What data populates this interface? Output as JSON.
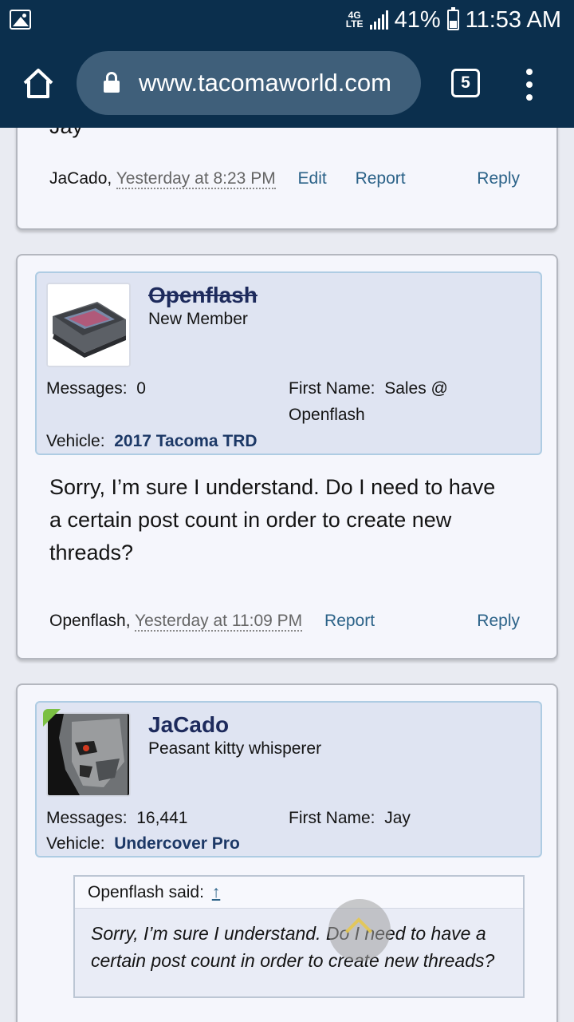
{
  "status_bar": {
    "network": "4G LTE",
    "battery": "41%",
    "time": "11:53 AM"
  },
  "browser": {
    "url": "www.tacomaworld.com",
    "tab_count": "5"
  },
  "posts": [
    {
      "partial_text": "Jay",
      "footer": {
        "author": "JaCado,",
        "date": "Yesterday at 8:23 PM",
        "edit_label": "Edit",
        "report_label": "Report",
        "reply_label": "Reply"
      }
    },
    {
      "user": {
        "name": "Openflash",
        "title": "New Member",
        "messages_label": "Messages:",
        "messages_value": "0",
        "first_name_label": "First Name:",
        "first_name_value": "Sales @",
        "first_name_value_2": "Openflash",
        "vehicle_label": "Vehicle:",
        "vehicle_value": "2017 Tacoma TRD"
      },
      "message_line_1": "Sorry, I’m sure I understand. Do I need to have",
      "message_line_2": "a certain post count in order to create new",
      "message_line_3": "threads?",
      "footer": {
        "author": "Openflash,",
        "date": "Yesterday at 11:09 PM",
        "report_label": "Report",
        "reply_label": "Reply"
      }
    },
    {
      "user": {
        "name": "JaCado",
        "title": "Peasant kitty whisperer",
        "messages_label": "Messages:",
        "messages_value": "16,441",
        "first_name_label": "First Name:",
        "first_name_value": "Jay",
        "vehicle_label": "Vehicle:",
        "vehicle_value": "Undercover Pro"
      },
      "quote": {
        "header": "Openflash said:",
        "arrow": "↑",
        "line_1": "Sorry, I’m sure I understand. Do I need to have a",
        "line_2": "certain post count in order to create new threads?"
      }
    }
  ]
}
